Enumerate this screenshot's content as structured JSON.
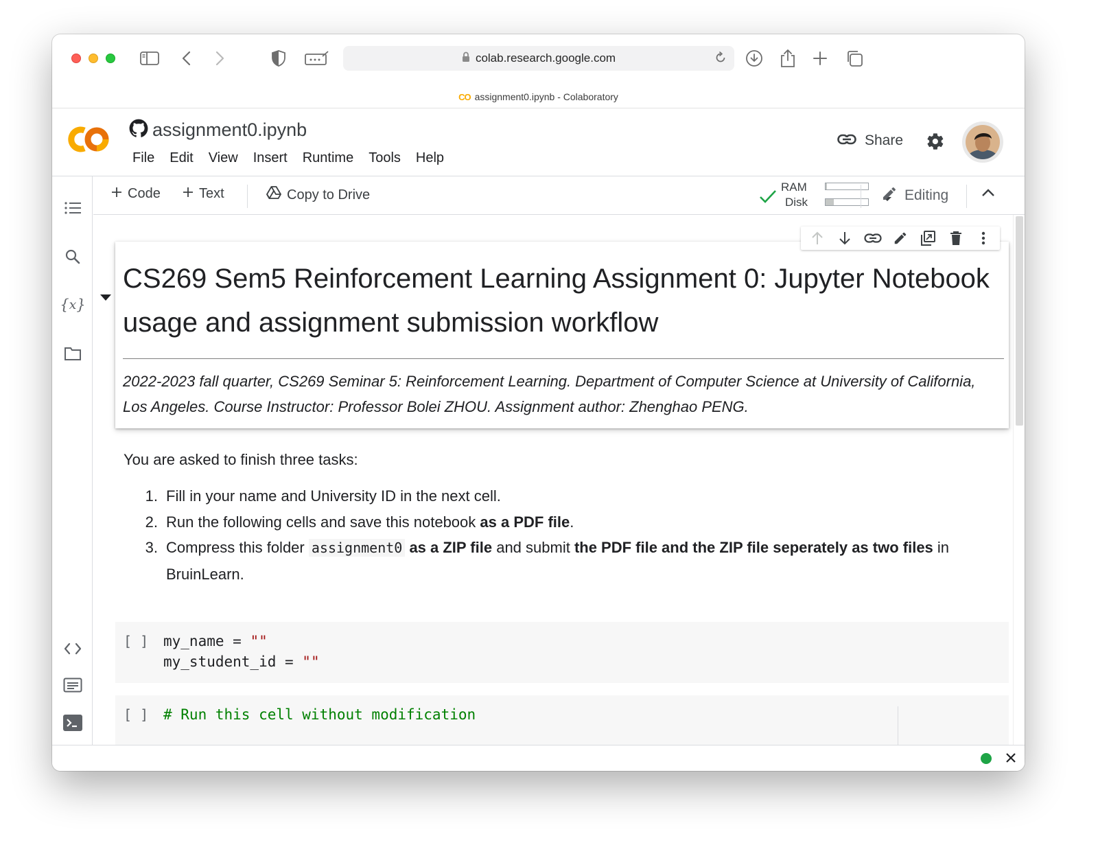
{
  "browser": {
    "url": "colab.research.google.com",
    "tab_title": "assignment0.ipynb - Colaboratory",
    "tab_logo": "CO"
  },
  "colab": {
    "logo_text": "CO",
    "notebook_title": "assignment0.ipynb",
    "menu": [
      "File",
      "Edit",
      "View",
      "Insert",
      "Runtime",
      "Tools",
      "Help"
    ],
    "share_label": "Share"
  },
  "toolbar": {
    "add_code": "Code",
    "add_text": "Text",
    "copy_to_drive": "Copy to Drive",
    "ram_label": "RAM",
    "disk_label": "Disk",
    "ram_usage_fraction": 0.03,
    "disk_usage_fraction": 0.2,
    "editing_label": "Editing"
  },
  "cells": {
    "heading": "CS269 Sem5 Reinforcement Learning Assignment 0: Jupyter Notebook usage and assignment submission workflow",
    "meta": "2022-2023 fall quarter, CS269 Seminar 5: Reinforcement Learning. Department of Computer Science at University of California, Los Angeles. Course Instructor: Professor Bolei ZHOU. Assignment author: Zhenghao PENG.",
    "intro": "You are asked to finish three tasks:",
    "tasks": [
      {
        "num": "1.",
        "parts": [
          "Fill in your name and University ID in the next cell."
        ]
      },
      {
        "num": "2.",
        "parts": [
          "Run the following cells and save this notebook ",
          "as a PDF file",
          "."
        ]
      },
      {
        "num": "3.",
        "parts": [
          "Compress this folder ",
          "assignment0",
          " ",
          "as a ZIP file",
          " and submit ",
          "the PDF file and the ZIP file seperately as two files",
          " in BruinLearn."
        ]
      }
    ],
    "code1": {
      "bracket": "[ ]",
      "line1_var": "my_name = ",
      "line1_str": "\"\"",
      "line2_var": "my_student_id = ",
      "line2_str": "\"\""
    },
    "code2": {
      "bracket": "[ ]",
      "comment": "# Run this cell without modification"
    }
  },
  "colors": {
    "accent_orange": "#f9ab00",
    "connected_green": "#1ea446",
    "string_red": "#a31515",
    "comment_green": "#008000"
  }
}
